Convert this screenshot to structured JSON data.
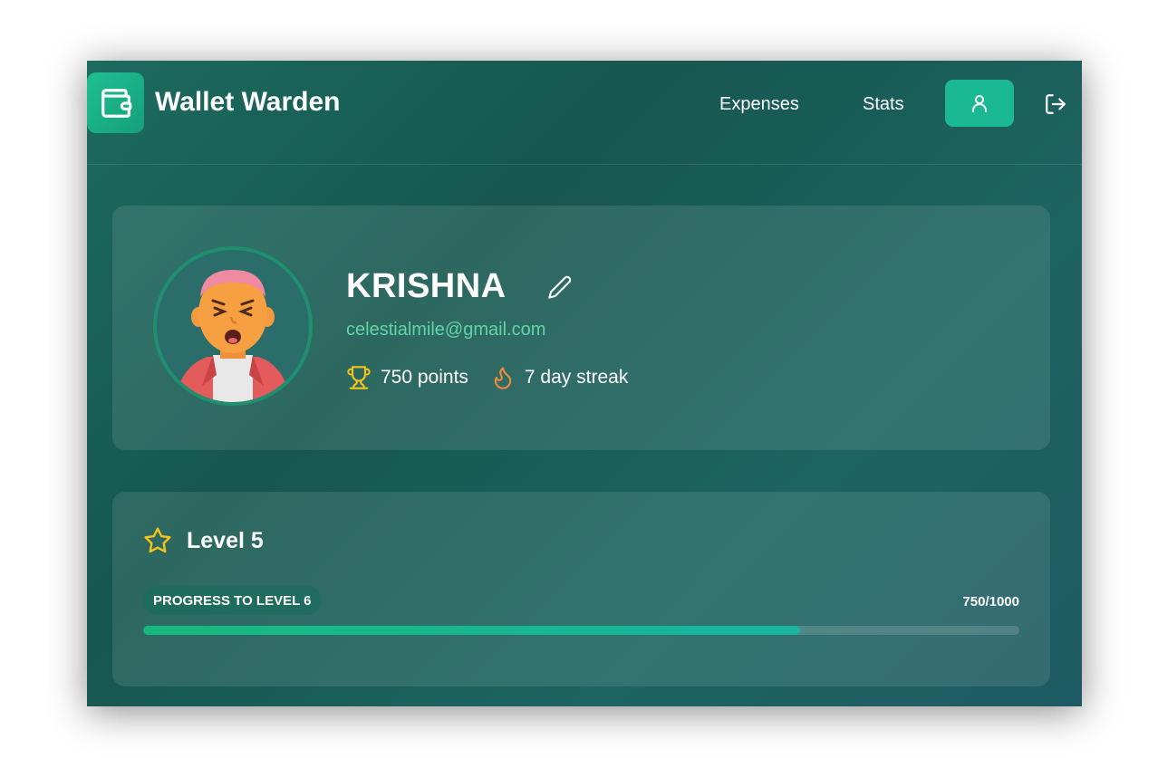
{
  "header": {
    "app_title": "Wallet Warden",
    "nav": [
      {
        "label": "Expenses"
      },
      {
        "label": "Stats"
      }
    ],
    "profile_icon": "user-icon",
    "logout_icon": "logout-icon",
    "brand_color": "#1ab893"
  },
  "profile": {
    "name": "KRISHNA",
    "email": "celestialmile@gmail.com",
    "points": "750 points",
    "streak": "7 day streak",
    "points_icon": "trophy-icon",
    "streak_icon": "flame-icon",
    "edit_icon": "pencil-icon"
  },
  "level": {
    "title": "Level 5",
    "icon": "star-icon",
    "progress_label": "PROGRESS TO LEVEL 6",
    "progress_count": "750/1000",
    "progress_fraction": 0.75
  }
}
